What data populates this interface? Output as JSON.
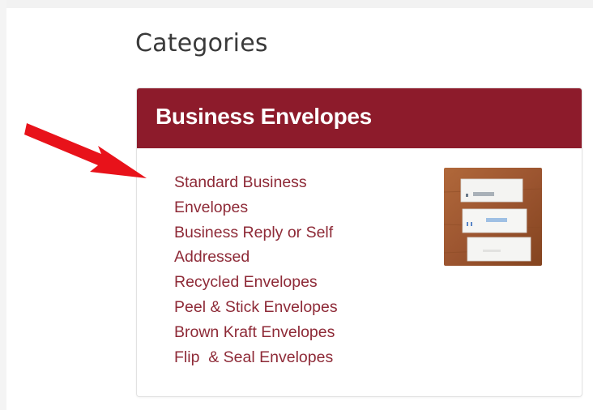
{
  "section": {
    "heading": "Categories"
  },
  "panel": {
    "title": "Business Envelopes",
    "links": [
      "Standard Business Envelopes",
      "Business Reply or Self Addressed",
      "Recycled Envelopes",
      "Peel & Stick Envelopes",
      "Brown Kraft Envelopes",
      "Flip  & Seal Envelopes"
    ],
    "thumbnail_icon": "envelope-photo-icon"
  },
  "annotation": {
    "icon": "red-arrow-icon"
  },
  "colors": {
    "header_bg": "#8d1b2b",
    "link": "#8e2a37",
    "arrow": "#e8121a",
    "heading_text": "#3a3a3a"
  }
}
